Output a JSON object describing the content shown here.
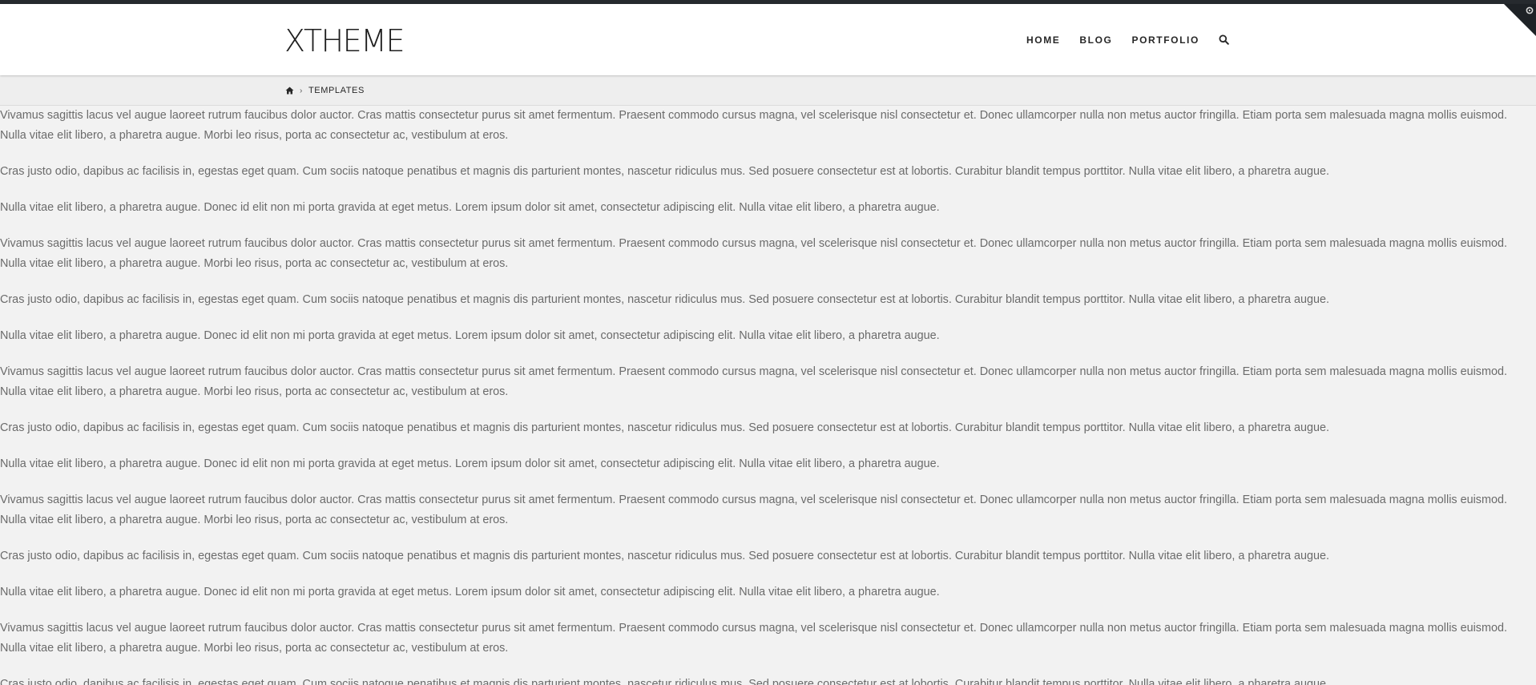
{
  "header": {
    "logo": "XTHEME",
    "nav": [
      {
        "label": "HOME"
      },
      {
        "label": "BLOG"
      },
      {
        "label": "PORTFOLIO"
      }
    ],
    "search_icon": "search-icon",
    "corner_icon": "gear-icon"
  },
  "breadcrumb": {
    "home_icon": "home-icon",
    "separator": "›",
    "current": "TEMPLATES"
  },
  "content": {
    "paragraphs": [
      "Vivamus sagittis lacus vel augue laoreet rutrum faucibus dolor auctor. Cras mattis consectetur purus sit amet fermentum. Praesent commodo cursus magna, vel scelerisque nisl consectetur et. Donec ullamcorper nulla non metus auctor fringilla. Etiam porta sem malesuada magna mollis euismod.\nNulla vitae elit libero, a pharetra augue. Morbi leo risus, porta ac consectetur ac, vestibulum at eros.",
      "Cras justo odio, dapibus ac facilisis in, egestas eget quam. Cum sociis natoque penatibus et magnis dis parturient montes, nascetur ridiculus mus. Sed posuere consectetur est at lobortis. Curabitur blandit tempus porttitor. Nulla vitae elit libero, a pharetra augue.",
      "Nulla vitae elit libero, a pharetra augue. Donec id elit non mi porta gravida at eget metus. Lorem ipsum dolor sit amet, consectetur adipiscing elit. Nulla vitae elit libero, a pharetra augue.",
      "Vivamus sagittis lacus vel augue laoreet rutrum faucibus dolor auctor. Cras mattis consectetur purus sit amet fermentum. Praesent commodo cursus magna, vel scelerisque nisl consectetur et. Donec ullamcorper nulla non metus auctor fringilla. Etiam porta sem malesuada magna mollis euismod.\nNulla vitae elit libero, a pharetra augue. Morbi leo risus, porta ac consectetur ac, vestibulum at eros.",
      "Cras justo odio, dapibus ac facilisis in, egestas eget quam. Cum sociis natoque penatibus et magnis dis parturient montes, nascetur ridiculus mus. Sed posuere consectetur est at lobortis. Curabitur blandit tempus porttitor. Nulla vitae elit libero, a pharetra augue.",
      "Nulla vitae elit libero, a pharetra augue. Donec id elit non mi porta gravida at eget metus. Lorem ipsum dolor sit amet, consectetur adipiscing elit. Nulla vitae elit libero, a pharetra augue.",
      "Vivamus sagittis lacus vel augue laoreet rutrum faucibus dolor auctor. Cras mattis consectetur purus sit amet fermentum. Praesent commodo cursus magna, vel scelerisque nisl consectetur et. Donec ullamcorper nulla non metus auctor fringilla. Etiam porta sem malesuada magna mollis euismod.\nNulla vitae elit libero, a pharetra augue. Morbi leo risus, porta ac consectetur ac, vestibulum at eros.",
      "Cras justo odio, dapibus ac facilisis in, egestas eget quam. Cum sociis natoque penatibus et magnis dis parturient montes, nascetur ridiculus mus. Sed posuere consectetur est at lobortis. Curabitur blandit tempus porttitor. Nulla vitae elit libero, a pharetra augue.",
      "Nulla vitae elit libero, a pharetra augue. Donec id elit non mi porta gravida at eget metus. Lorem ipsum dolor sit amet, consectetur adipiscing elit. Nulla vitae elit libero, a pharetra augue.",
      "Vivamus sagittis lacus vel augue laoreet rutrum faucibus dolor auctor. Cras mattis consectetur purus sit amet fermentum. Praesent commodo cursus magna, vel scelerisque nisl consectetur et. Donec ullamcorper nulla non metus auctor fringilla. Etiam porta sem malesuada magna mollis euismod.\nNulla vitae elit libero, a pharetra augue. Morbi leo risus, porta ac consectetur ac, vestibulum at eros.",
      "Cras justo odio, dapibus ac facilisis in, egestas eget quam. Cum sociis natoque penatibus et magnis dis parturient montes, nascetur ridiculus mus. Sed posuere consectetur est at lobortis. Curabitur blandit tempus porttitor. Nulla vitae elit libero, a pharetra augue.",
      "Nulla vitae elit libero, a pharetra augue. Donec id elit non mi porta gravida at eget metus. Lorem ipsum dolor sit amet, consectetur adipiscing elit. Nulla vitae elit libero, a pharetra augue.",
      "Vivamus sagittis lacus vel augue laoreet rutrum faucibus dolor auctor. Cras mattis consectetur purus sit amet fermentum. Praesent commodo cursus magna, vel scelerisque nisl consectetur et. Donec ullamcorper nulla non metus auctor fringilla. Etiam porta sem malesuada magna mollis euismod.\nNulla vitae elit libero, a pharetra augue. Morbi leo risus, porta ac consectetur ac, vestibulum at eros.",
      "Cras justo odio, dapibus ac facilisis in, egestas eget quam. Cum sociis natoque penatibus et magnis dis parturient montes, nascetur ridiculus mus. Sed posuere consectetur est at lobortis. Curabitur blandit tempus porttitor. Nulla vitae elit libero, a pharetra augue."
    ]
  },
  "colors": {
    "topbar": "#262a2e",
    "page_background": "#f2f2f2",
    "text": "#6b6b6b",
    "nav_text": "#272727"
  }
}
